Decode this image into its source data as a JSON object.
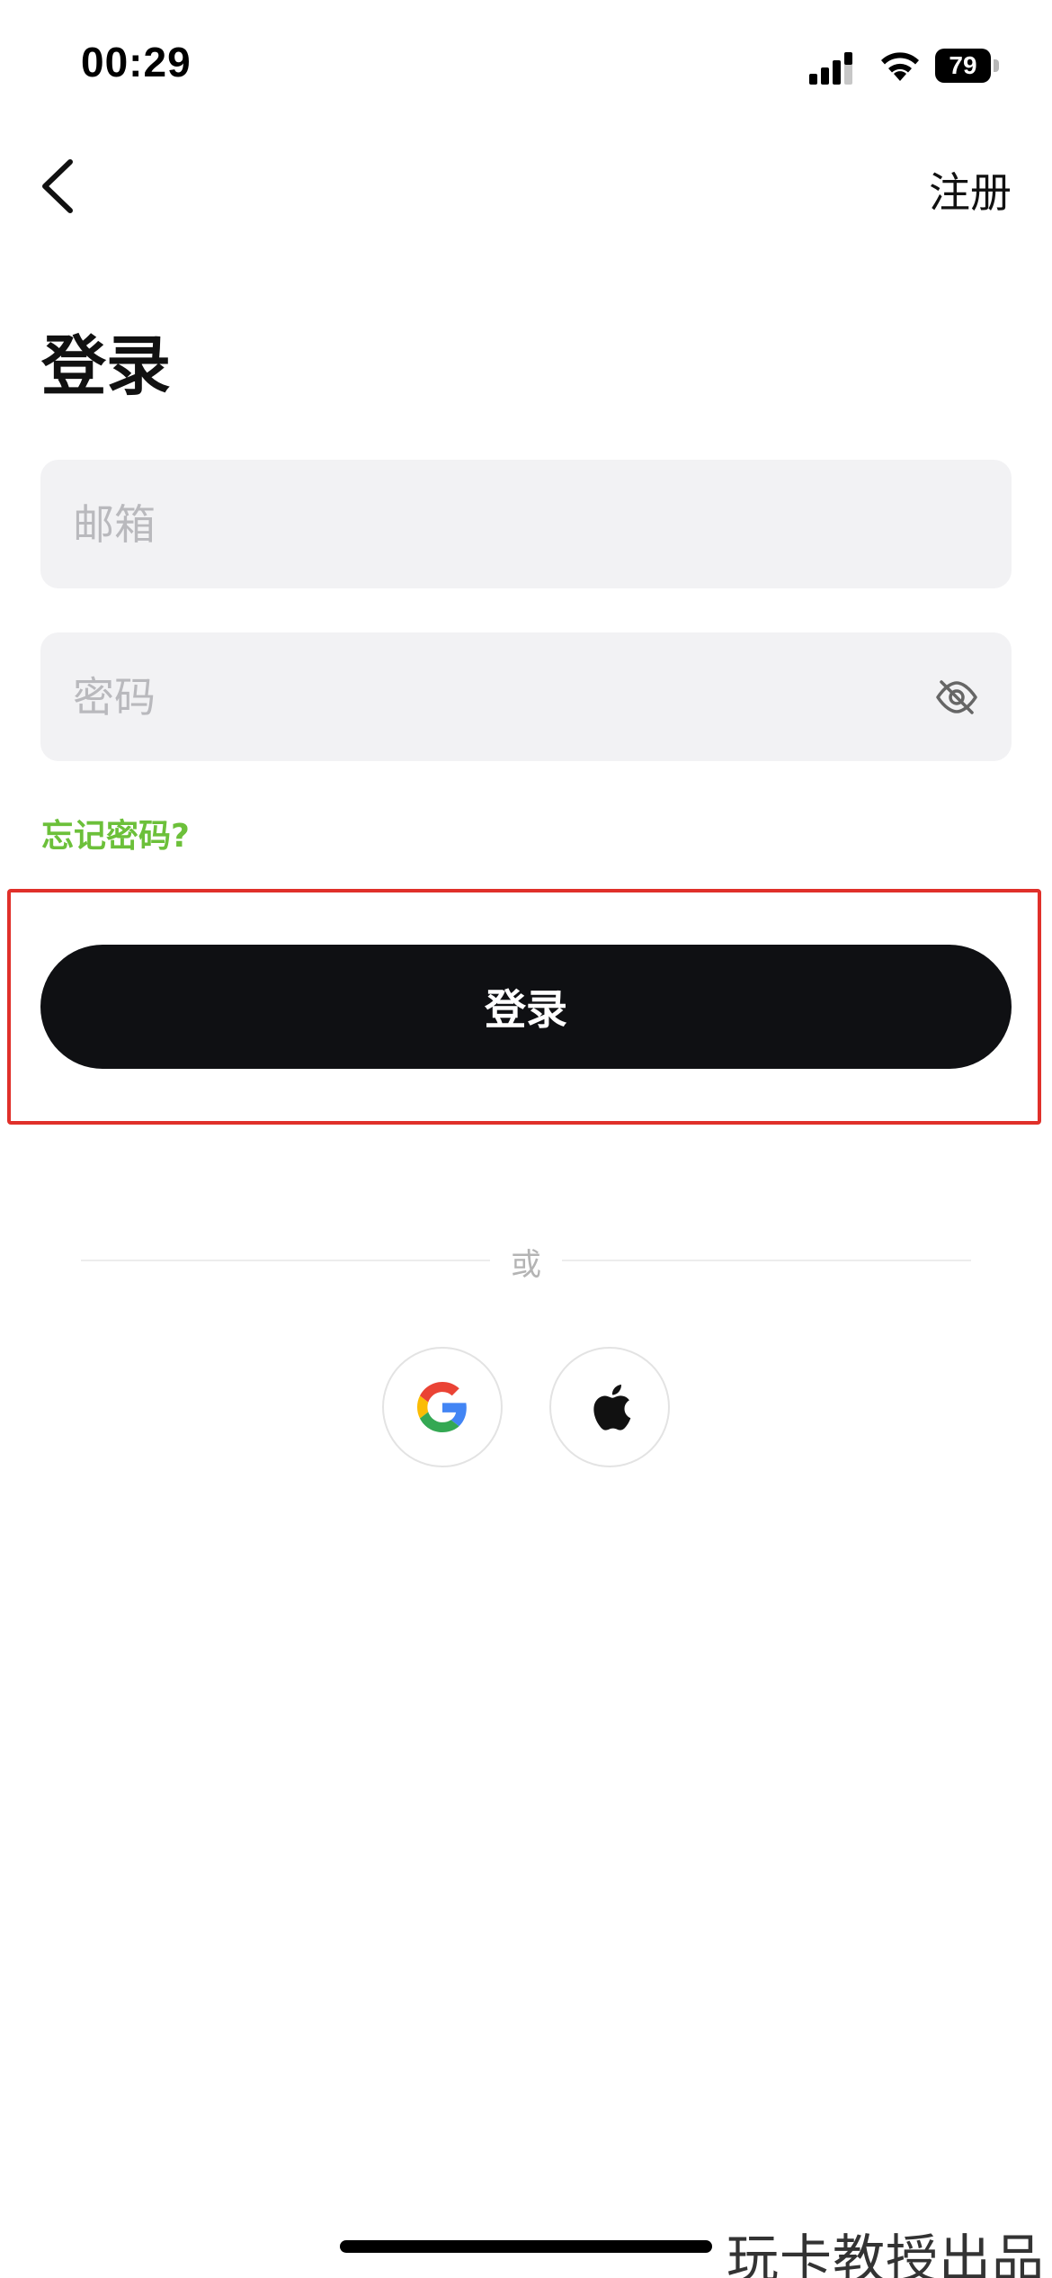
{
  "status_bar": {
    "time": "00:29",
    "battery_level": "79"
  },
  "nav": {
    "register_label": "注册"
  },
  "title": "登录",
  "form": {
    "email_placeholder": "邮箱",
    "password_placeholder": "密码",
    "forgot_password_label": "忘记密码?",
    "login_button_label": "登录"
  },
  "divider": {
    "text": "或"
  },
  "social": {
    "providers": [
      "google-icon",
      "apple-icon"
    ]
  },
  "watermark": "玩卡教授出品",
  "colors": {
    "accent_green": "#6cc03a",
    "button_dark": "#0f1013",
    "field_bg": "#f2f2f4",
    "highlight_red": "#e0302a"
  }
}
